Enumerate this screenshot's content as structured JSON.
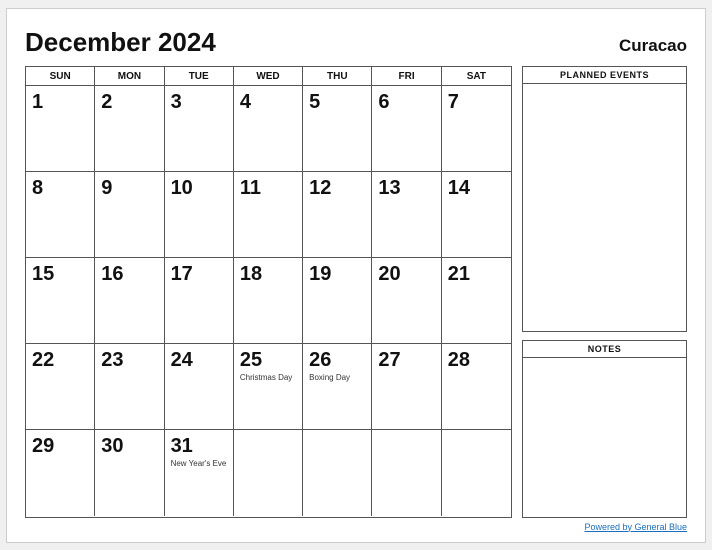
{
  "header": {
    "title": "December 2024",
    "location": "Curacao"
  },
  "day_headers": [
    "SUN",
    "MON",
    "TUE",
    "WED",
    "THU",
    "FRI",
    "SAT"
  ],
  "weeks": [
    [
      {
        "num": "1",
        "event": ""
      },
      {
        "num": "2",
        "event": ""
      },
      {
        "num": "3",
        "event": ""
      },
      {
        "num": "4",
        "event": ""
      },
      {
        "num": "5",
        "event": ""
      },
      {
        "num": "6",
        "event": ""
      },
      {
        "num": "7",
        "event": ""
      }
    ],
    [
      {
        "num": "8",
        "event": ""
      },
      {
        "num": "9",
        "event": ""
      },
      {
        "num": "10",
        "event": ""
      },
      {
        "num": "11",
        "event": ""
      },
      {
        "num": "12",
        "event": ""
      },
      {
        "num": "13",
        "event": ""
      },
      {
        "num": "14",
        "event": ""
      }
    ],
    [
      {
        "num": "15",
        "event": ""
      },
      {
        "num": "16",
        "event": ""
      },
      {
        "num": "17",
        "event": ""
      },
      {
        "num": "18",
        "event": ""
      },
      {
        "num": "19",
        "event": ""
      },
      {
        "num": "20",
        "event": ""
      },
      {
        "num": "21",
        "event": ""
      }
    ],
    [
      {
        "num": "22",
        "event": ""
      },
      {
        "num": "23",
        "event": ""
      },
      {
        "num": "24",
        "event": ""
      },
      {
        "num": "25",
        "event": "Christmas Day"
      },
      {
        "num": "26",
        "event": "Boxing Day"
      },
      {
        "num": "27",
        "event": ""
      },
      {
        "num": "28",
        "event": ""
      }
    ],
    [
      {
        "num": "29",
        "event": ""
      },
      {
        "num": "30",
        "event": ""
      },
      {
        "num": "31",
        "event": "New Year's Eve"
      },
      {
        "num": "",
        "event": ""
      },
      {
        "num": "",
        "event": ""
      },
      {
        "num": "",
        "event": ""
      },
      {
        "num": "",
        "event": ""
      }
    ]
  ],
  "side": {
    "planned_events_label": "PLANNED EVENTS",
    "notes_label": "NOTES"
  },
  "footer": {
    "link_text": "Powered by General Blue"
  }
}
